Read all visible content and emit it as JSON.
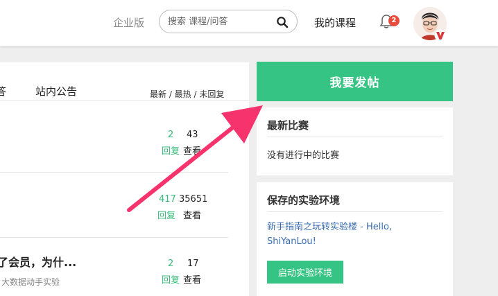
{
  "header": {
    "enterprise_label": "企业版",
    "search_placeholder": "搜索 课程/问答",
    "my_courses_label": "我的课程",
    "notification_count": "2"
  },
  "forum": {
    "tab_partial": "答",
    "tab_announcements": "站内公告",
    "sort_options": "最新 / 最热 / 未回复",
    "threads": [
      {
        "title": "",
        "subtitle": "",
        "replies": "2",
        "replies_label": "回复",
        "views": "43",
        "views_label": "查看"
      },
      {
        "title": "",
        "subtitle": "",
        "replies": "417",
        "replies_label": "回复",
        "views": "35651",
        "views_label": "查看"
      },
      {
        "title": "了会员，为什...",
        "subtitle": "大数据动手实验",
        "replies": "2",
        "replies_label": "回复",
        "views": "17",
        "views_label": "查看"
      }
    ]
  },
  "sidebar": {
    "post_button": "我要发帖",
    "latest_contest": {
      "title": "最新比赛",
      "text": "没有进行中的比赛"
    },
    "saved_env": {
      "title": "保存的实验环境",
      "link": "新手指南之玩转实验楼 - Hello, ShiYanLou!",
      "button": "启动实验环境"
    }
  },
  "colors": {
    "accent_green": "#35c483",
    "arrow_pink": "#f7336e",
    "badge_red": "#e74c3c",
    "link_blue": "#3a6db0"
  }
}
